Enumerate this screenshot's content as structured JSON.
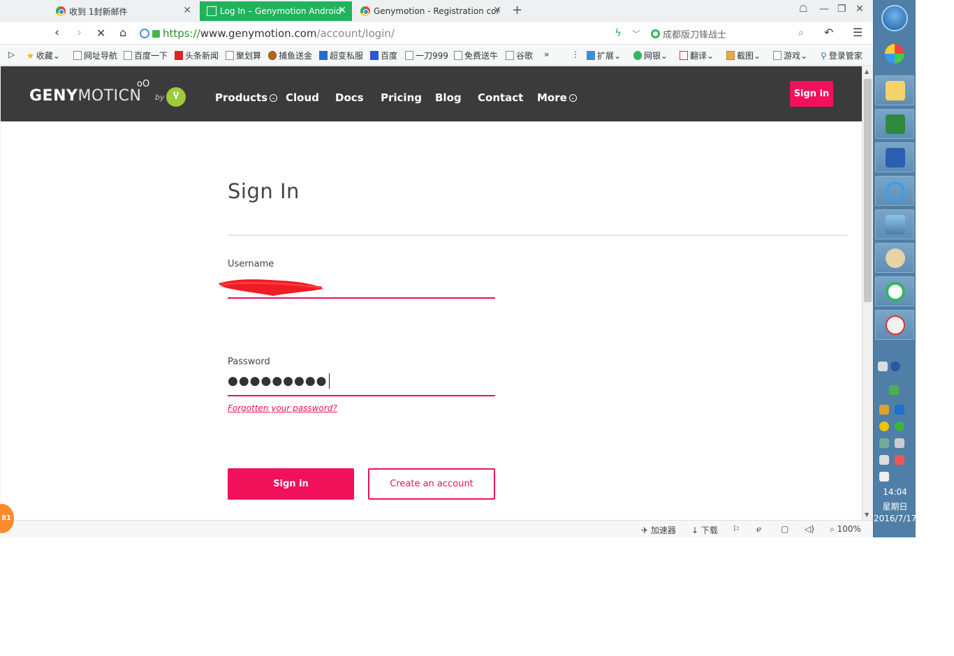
{
  "browser": {
    "tabs": [
      {
        "label": "收到 1封新邮件",
        "active": false
      },
      {
        "label": "Log In – Genymotion Android",
        "active": true
      },
      {
        "label": "Genymotion - Registration cor",
        "active": false
      }
    ],
    "url": {
      "scheme": "https://",
      "host": "www.genymotion.com",
      "path": "/account/login/"
    },
    "search_placeholder": "成都版刀锋战士",
    "bookmarks": [
      "收藏",
      "网址导航",
      "百度一下",
      "头条新闻",
      "聚划算",
      "捕鱼送金",
      "超变私服",
      "百度",
      "一刀999",
      "免费送牛",
      "谷歌",
      "扩展",
      "网银",
      "翻译",
      "截图",
      "游戏",
      "登录管家"
    ],
    "statusbar": {
      "accelerator": "加速器",
      "download": "下载",
      "zoom": "100%"
    },
    "badge_count": "81"
  },
  "site": {
    "brand_bold": "GENY",
    "brand_light": "MOTICN",
    "brand_suffix": "oO",
    "by": "by",
    "nav": [
      "Products",
      "Cloud",
      "Docs",
      "Pricing",
      "Blog",
      "Contact",
      "More"
    ],
    "header_signin": "Sign in"
  },
  "form": {
    "title": "Sign In",
    "username_label": "Username",
    "password_label": "Password",
    "password_value": "●●●●●●●●●",
    "forgot_link": "Forgotten your password?",
    "submit_label": "Sign in",
    "create_label": "Create an account"
  },
  "taskbar": {
    "time": "14:04",
    "weekday": "星期日",
    "date": "2016/7/17"
  },
  "colors": {
    "accent": "#f0115a",
    "header_bg": "#3b3b3b",
    "tab_active": "#21b35c",
    "taskbar": "#4f7fa6"
  }
}
